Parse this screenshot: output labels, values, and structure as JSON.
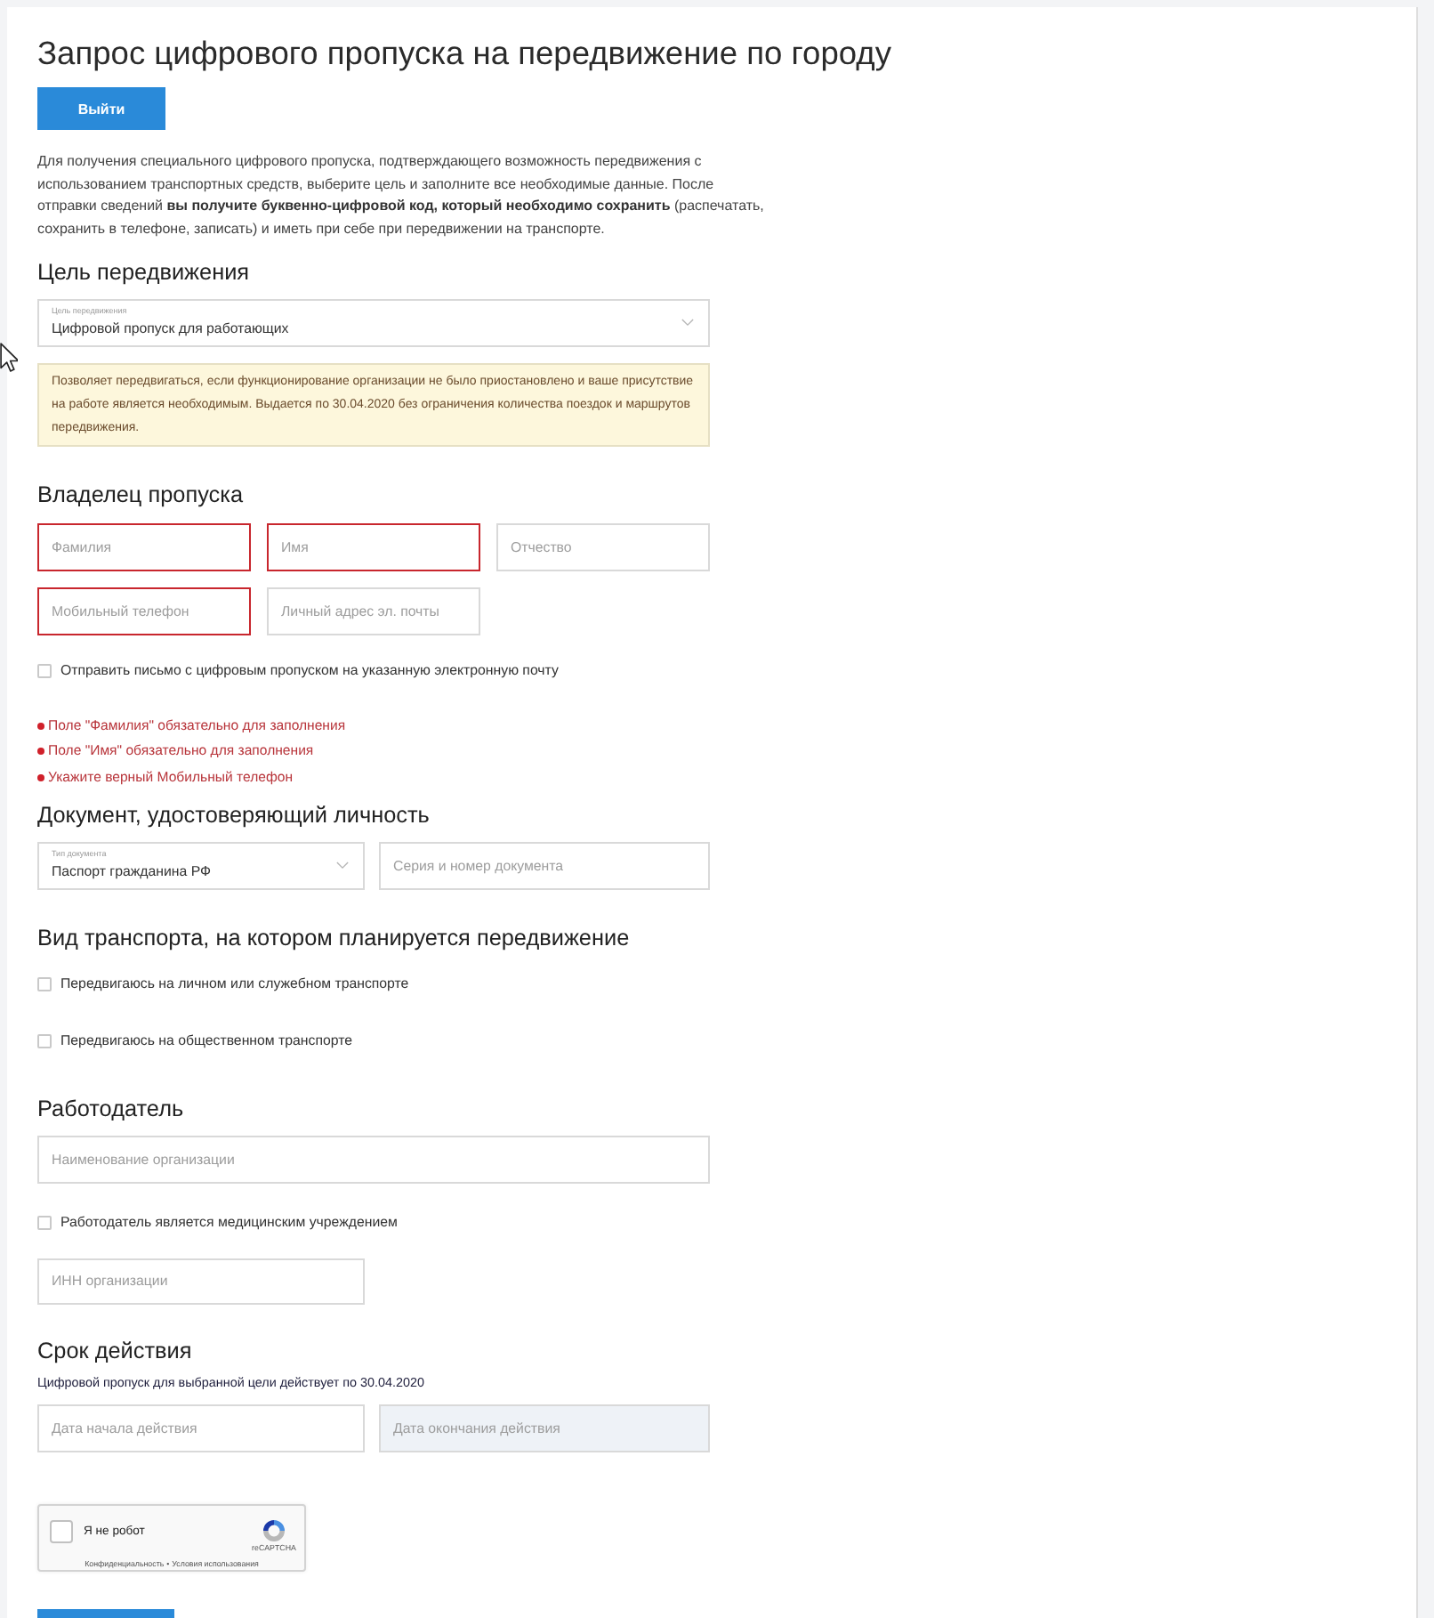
{
  "page": {
    "title": "Запрос цифрового пропуска на передвижение по городу",
    "logout_button": "Выйти",
    "intro": "Для получения специального цифрового пропуска, подтверждающего возможность передвижения с использованием транспортных средств, выберите цель и заполните все необходимые данные. После отправки сведений **вы получите буквенно-цифровой код, который необходимо сохранить** (распечатать, сохранить в телефоне, записать) и иметь при себе при передвижении на транспорте."
  },
  "purpose": {
    "heading": "Цель передвижения",
    "select": {
      "label": "Цель передвижения",
      "value": "Цифровой пропуск для работающих"
    },
    "notice": "Позволяет передвигаться, если функционирование организации не было приостановлено и ваше присутствие на работе является необходимым. Выдается по 30.04.2020 без ограничения количества поездок и маршрутов передвижения."
  },
  "owner": {
    "heading": "Владелец пропуска",
    "fields": [
      {
        "placeholder": "Фамилия",
        "invalid": true
      },
      {
        "placeholder": "Имя",
        "invalid": true
      },
      {
        "placeholder": "Отчество",
        "invalid": false
      },
      {
        "placeholder": "Мобильный телефон",
        "invalid": true
      },
      {
        "placeholder": "Личный адрес эл. почты",
        "invalid": false
      }
    ],
    "email_checkbox": {
      "label": "Отправить письмо с цифровым пропуском на указанную электронную почту",
      "checked": false
    },
    "errors": [
      "Поле \"Фамилия\" обязательно для заполнения",
      "Поле \"Имя\" обязательно для заполнения",
      "Укажите верный Мобильный телефон"
    ]
  },
  "document": {
    "heading": "Документ, удостоверяющий личность",
    "select": {
      "label": "Тип документа",
      "value": "Паспорт гражданина РФ"
    },
    "number_field": {
      "placeholder": "Серия и номер документа"
    }
  },
  "transport": {
    "heading": "Вид транспорта, на котором планируется передвижение",
    "options": [
      {
        "label": "Передвигаюсь на личном или служебном транспорте",
        "checked": false
      },
      {
        "label": "Передвигаюсь на общественном транспорте",
        "checked": false
      }
    ]
  },
  "employer": {
    "heading": "Работодатель",
    "name_field": {
      "placeholder": "Наименование организации"
    },
    "medical_checkbox": {
      "label": "Работодатель является медицинским учреждением",
      "checked": false
    },
    "inn_field": {
      "placeholder": "ИНН организации"
    }
  },
  "validity": {
    "heading": "Срок действия",
    "note": "Цифровой пропуск для выбранной цели действует по 30.04.2020",
    "fields": [
      {
        "placeholder": "Дата начала действия",
        "disabled": false
      },
      {
        "placeholder": "Дата окончания действия",
        "disabled": true
      }
    ]
  },
  "captcha": {
    "label": "Я не робот",
    "checked": false,
    "brand": "reCAPTCHA",
    "links": [
      "Конфиденциальность",
      "Условия использования"
    ],
    "separator": "•"
  }
}
